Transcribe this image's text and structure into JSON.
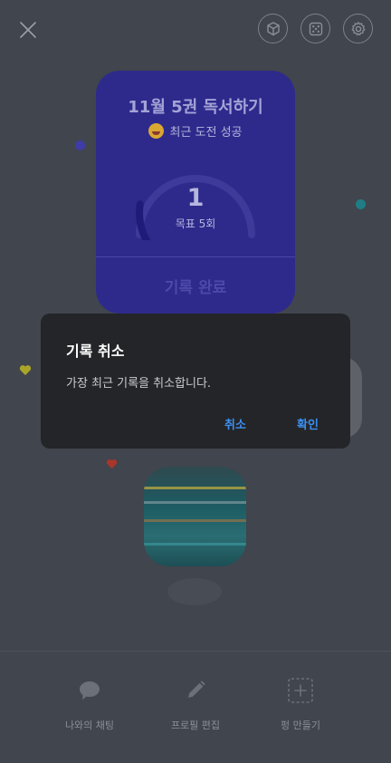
{
  "top_bar": {
    "close_icon": "close-icon",
    "icons": [
      "cube-icon",
      "dice-icon",
      "gear-icon"
    ]
  },
  "card": {
    "title": "11월 5권 독서하기",
    "subtitle": "최근 도전 성공",
    "count": "1",
    "goal": "목표 5회",
    "done_button": "기록 완료",
    "progress": 0.2,
    "color": "#2e2a8c"
  },
  "dialog": {
    "title": "기록 취소",
    "message": "가장 최근 기록을 취소합니다.",
    "cancel_label": "취소",
    "confirm_label": "확인",
    "accent": "#3b8ff0"
  },
  "bottom_nav": {
    "items": [
      {
        "label": "나와의 채팅",
        "icon": "chat-bubble-icon"
      },
      {
        "label": "프로필 편집",
        "icon": "pencil-icon"
      },
      {
        "label": "펑 만들기",
        "icon": "add-square-icon"
      }
    ]
  }
}
